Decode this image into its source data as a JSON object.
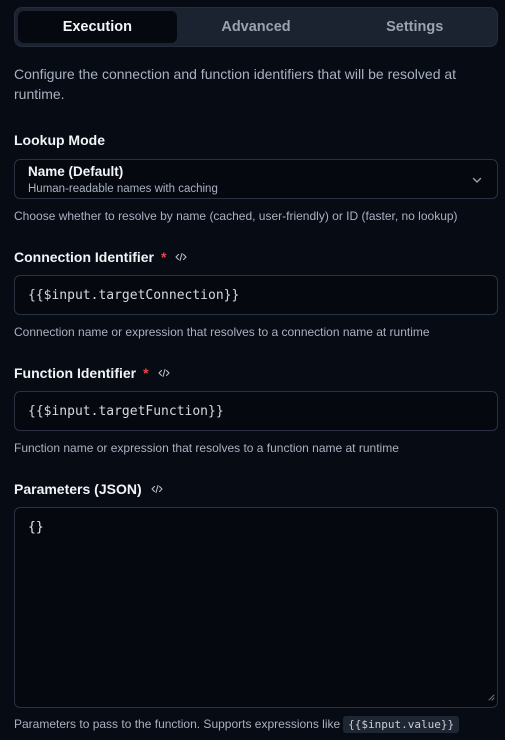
{
  "tabs": [
    {
      "label": "Execution",
      "active": true
    },
    {
      "label": "Advanced",
      "active": false
    },
    {
      "label": "Settings",
      "active": false
    }
  ],
  "intro": "Configure the connection and function identifiers that will be resolved at runtime.",
  "lookup_mode": {
    "label": "Lookup Mode",
    "selected": "Name (Default)",
    "selected_description": "Human-readable names with caching",
    "help": "Choose whether to resolve by name (cached, user-friendly) or ID (faster, no lookup)"
  },
  "connection_identifier": {
    "label": "Connection Identifier",
    "required_marker": "*",
    "value": "{{$input.targetConnection}}",
    "help": "Connection name or expression that resolves to a connection name at runtime"
  },
  "function_identifier": {
    "label": "Function Identifier",
    "required_marker": "*",
    "value": "{{$input.targetFunction}}",
    "help": "Function name or expression that resolves to a function name at runtime"
  },
  "parameters": {
    "label": "Parameters (JSON)",
    "value": "{}",
    "help_prefix": "Parameters to pass to the function. Supports expressions like",
    "help_code": "{{$input.value}}"
  },
  "icons": {
    "code": "code-icon",
    "chevron": "chevron-down-icon",
    "resize": "resize-handle-icon"
  },
  "colors": {
    "background": "#070b14",
    "required": "#ef4444",
    "tab_bar": "#1b2230",
    "active_tab": "#05080f"
  }
}
